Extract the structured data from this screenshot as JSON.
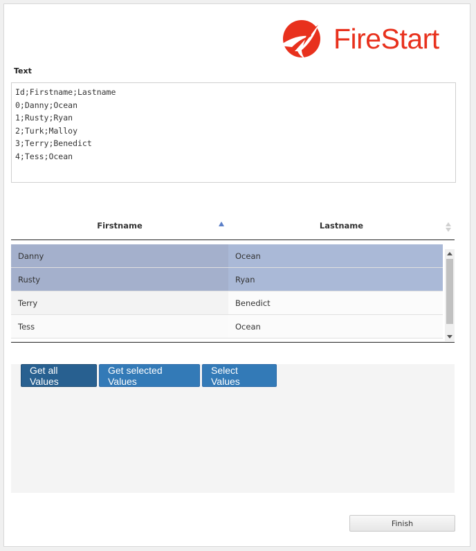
{
  "brand": {
    "name": "FireStart",
    "color": "#e8311d",
    "logo_icon": "rocket-icon"
  },
  "text_field": {
    "label": "Text",
    "value": "Id;Firstname;Lastname\n0;Danny;Ocean\n1;Rusty;Ryan\n2;Turk;Malloy\n3;Terry;Benedict\n4;Tess;Ocean"
  },
  "grid": {
    "columns": [
      {
        "label": "Firstname",
        "sort": "ascending"
      },
      {
        "label": "Lastname",
        "sort": "none"
      }
    ],
    "rows": [
      {
        "firstname": "Danny",
        "lastname": "Ocean",
        "selected": true
      },
      {
        "firstname": "Rusty",
        "lastname": "Ryan",
        "selected": true
      },
      {
        "firstname": "Terry",
        "lastname": "Benedict",
        "selected": false
      },
      {
        "firstname": "Tess",
        "lastname": "Ocean",
        "selected": false
      }
    ],
    "selection_color": "#aab9d7"
  },
  "actions": {
    "get_all": "Get all Values",
    "get_selected": "Get selected Values",
    "select_values": "Select Values",
    "button_color": "#337ab7"
  },
  "footer": {
    "finish_label": "Finish"
  }
}
